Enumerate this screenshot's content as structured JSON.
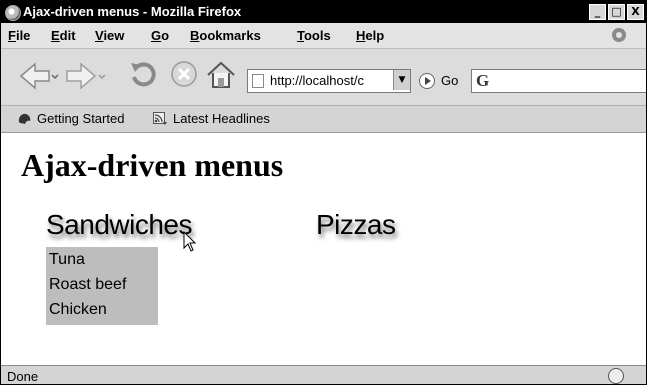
{
  "window": {
    "title": "Ajax-driven menus - Mozilla Firefox",
    "buttons": [
      "_",
      "□",
      "X"
    ]
  },
  "menubar": {
    "items": [
      "File",
      "Edit",
      "View",
      "Go",
      "Bookmarks",
      "Tools",
      "Help"
    ]
  },
  "navbar": {
    "url": "http://localhost/c",
    "go_label": "Go"
  },
  "bookmarks": {
    "items": [
      "Getting Started",
      "Latest Headlines"
    ]
  },
  "page": {
    "heading": "Ajax-driven menus",
    "menus": [
      {
        "title": "Sandwiches",
        "items": [
          "Tuna",
          "Roast beef",
          "Chicken"
        ]
      },
      {
        "title": "Pizzas",
        "items": []
      }
    ]
  },
  "statusbar": {
    "text": "Done"
  }
}
